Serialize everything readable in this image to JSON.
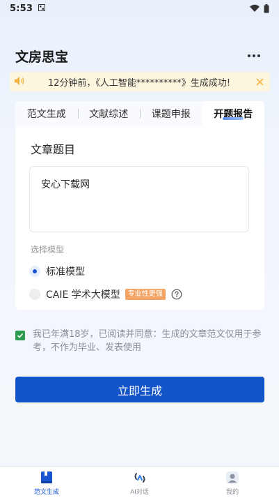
{
  "status_bar": {
    "time": "5:53",
    "notification_icon": "notification-icon",
    "wifi_icon": "wifi-icon",
    "battery_icon": "battery-icon"
  },
  "header": {
    "title": "文房思宝",
    "more_icon": "more-dots-icon"
  },
  "notice": {
    "icon": "speaker-icon",
    "text": "12分钟前，《人工智能**********》生成成功!",
    "close_icon": "close-icon"
  },
  "tabs": [
    {
      "label": "范文生成",
      "active": false
    },
    {
      "label": "文献综述",
      "active": false
    },
    {
      "label": "课题申报",
      "active": false
    },
    {
      "label": "开题报告",
      "active": true
    }
  ],
  "form": {
    "section_title": "文章题目",
    "topic_value": "安心下载网",
    "model_label": "选择模型",
    "models": [
      {
        "label": "标准模型",
        "checked": true
      },
      {
        "label": "CAIE 学术大模型",
        "checked": false,
        "badge": "专业性更强",
        "help_icon": "question-icon"
      }
    ]
  },
  "agreement": {
    "checked": true,
    "text": "我已年满18岁，已阅读并同意：生成的文章范文仅用于参考，不作为毕业、发表使用"
  },
  "generate_button": "立即生成",
  "bottom_nav": [
    {
      "label": "范文生成",
      "icon": "book-icon",
      "active": true
    },
    {
      "label": "AI对话",
      "icon": "ai-chat-icon",
      "active": false
    },
    {
      "label": "我的",
      "icon": "profile-icon",
      "active": false
    }
  ],
  "colors": {
    "primary": "#1355c8",
    "notice_bg": "#fdf6df",
    "badge": "#f4a565",
    "check": "#2d9a4f"
  }
}
